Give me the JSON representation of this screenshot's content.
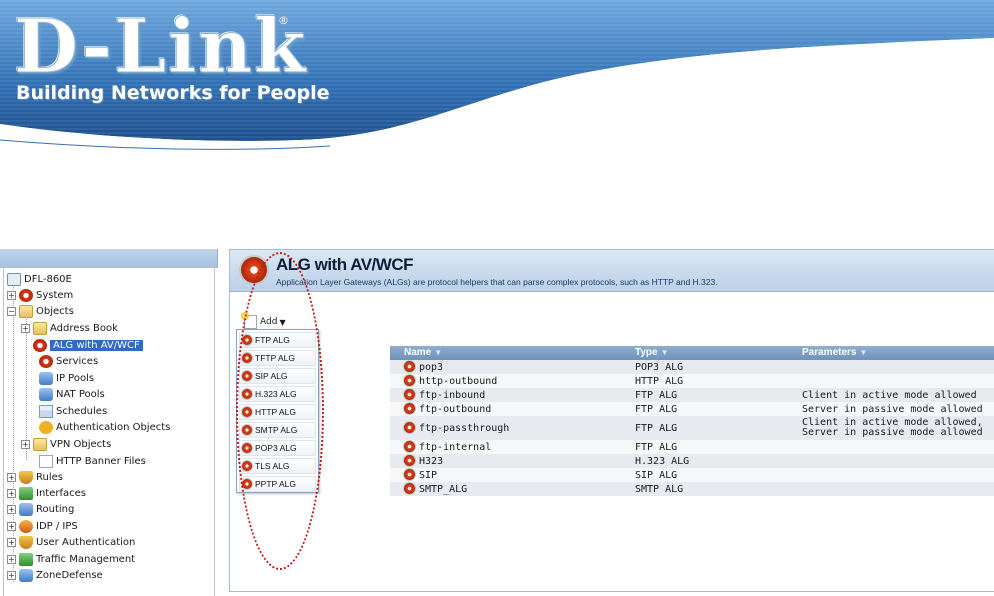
{
  "brand": {
    "logo_text": "D-Link",
    "registered_mark": "®",
    "tagline": "Building Networks for People"
  },
  "tree": {
    "items": [
      {
        "label": "DFL-860E",
        "icon": "device-icon"
      },
      {
        "label": "System",
        "icon": "gear-icon"
      },
      {
        "label": "Objects",
        "icon": "folder-icon"
      },
      {
        "label": "Address Book",
        "icon": "address-book-icon"
      },
      {
        "label": "ALG with AV/WCF",
        "icon": "alg-icon",
        "selected": true
      },
      {
        "label": "Services",
        "icon": "services-icon"
      },
      {
        "label": "IP Pools",
        "icon": "ip-pools-icon"
      },
      {
        "label": "NAT Pools",
        "icon": "nat-pools-icon"
      },
      {
        "label": "Schedules",
        "icon": "schedules-icon"
      },
      {
        "label": "Authentication Objects",
        "icon": "key-icon"
      },
      {
        "label": "VPN Objects",
        "icon": "vpn-folder-icon"
      },
      {
        "label": "HTTP Banner Files",
        "icon": "page-icon"
      },
      {
        "label": "Rules",
        "icon": "rules-icon"
      },
      {
        "label": "Interfaces",
        "icon": "interfaces-icon"
      },
      {
        "label": "Routing",
        "icon": "routing-icon"
      },
      {
        "label": "IDP / IPS",
        "icon": "idp-icon"
      },
      {
        "label": "User Authentication",
        "icon": "user-auth-icon"
      },
      {
        "label": "Traffic Management",
        "icon": "traffic-icon"
      },
      {
        "label": "ZoneDefense",
        "icon": "zonedefense-icon"
      }
    ]
  },
  "main": {
    "title": "ALG with AV/WCF",
    "description": "Application Layer Gateways (ALGs) are protocol helpers that can parse complex protocols, such as HTTP and H.323.",
    "add_label": "Add",
    "add_menu": [
      "FTP ALG",
      "TFTP ALG",
      "SIP ALG",
      "H.323 ALG",
      "HTTP ALG",
      "SMTP ALG",
      "POP3 ALG",
      "TLS ALG",
      "PPTP ALG"
    ],
    "table": {
      "columns": [
        "Name",
        "Type",
        "Parameters"
      ],
      "sort_glyph": "▼",
      "rows": [
        {
          "name": "pop3",
          "type": "POP3 ALG",
          "params": ""
        },
        {
          "name": "http-outbound",
          "type": "HTTP ALG",
          "params": ""
        },
        {
          "name": "ftp-inbound",
          "type": "FTP ALG",
          "params": "Client in active mode allowed"
        },
        {
          "name": "ftp-outbound",
          "type": "FTP ALG",
          "params": "Server in passive mode allowed"
        },
        {
          "name": "ftp-passthrough",
          "type": "FTP ALG",
          "params": "Client in active mode allowed, Server in passive mode allowed"
        },
        {
          "name": "ftp-internal",
          "type": "FTP ALG",
          "params": ""
        },
        {
          "name": "H323",
          "type": "H.323 ALG",
          "params": ""
        },
        {
          "name": "SIP",
          "type": "SIP ALG",
          "params": ""
        },
        {
          "name": "SMTP_ALG",
          "type": "SMTP ALG",
          "params": "",
          "index": "9"
        }
      ]
    }
  },
  "colors": {
    "banner_blue": "#2f6fb4",
    "header_bg": "#c8d9ec",
    "table_header": "#7f9fc6",
    "selection": "#316ac5",
    "annotation": "#c01818"
  }
}
